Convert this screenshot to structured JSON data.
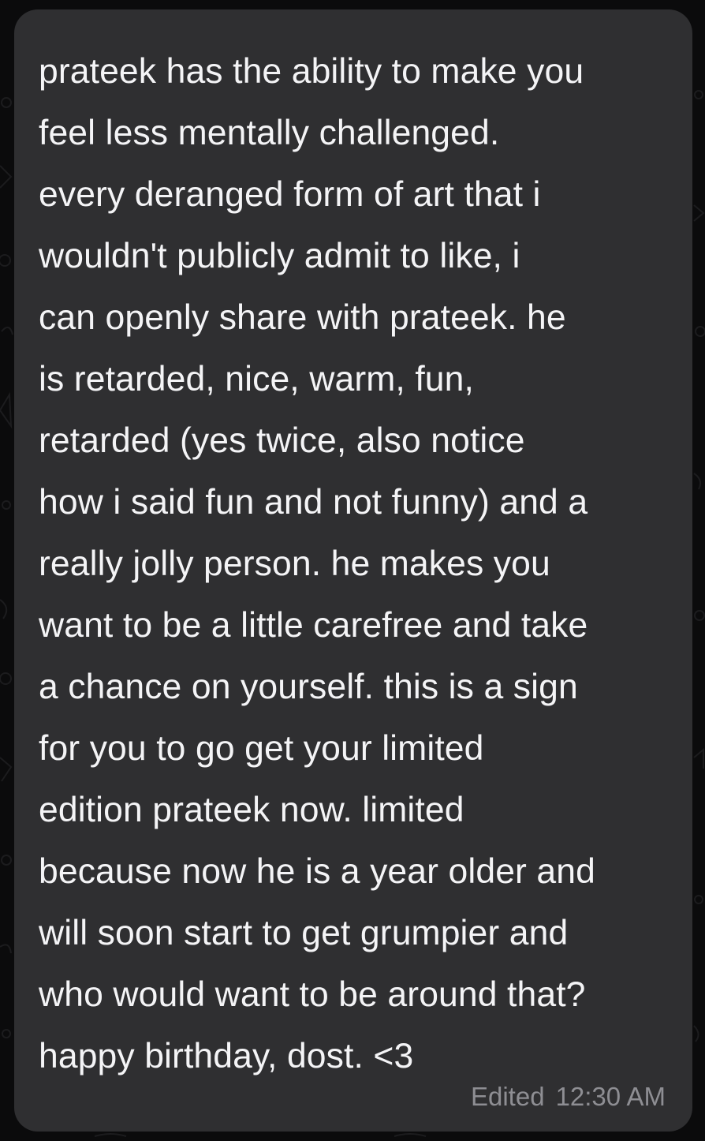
{
  "message": {
    "lines": [
      "prateek has the ability to make you",
      "feel less mentally challenged.",
      "every deranged form of art that i",
      "wouldn't publicly admit to like, i",
      "can openly share with prateek. he",
      "is retarded, nice, warm, fun,",
      "retarded (yes twice, also notice",
      "how i said fun and not funny) and a",
      "really jolly person. he makes you",
      "want to be a little carefree and take",
      "a chance on yourself. this is a sign",
      "for you to go get your limited",
      "edition prateek now. limited",
      "because now he is a year older and",
      "will soon start to get grumpier and",
      "who would want to be around that?",
      "happy birthday, dost. <3"
    ],
    "edited_label": "Edited",
    "time": "12:30 AM"
  },
  "colors": {
    "bubble": "#2f2f31",
    "text": "#f4f4f6",
    "meta": "#8e8e93",
    "background": "#0b0b0c"
  }
}
